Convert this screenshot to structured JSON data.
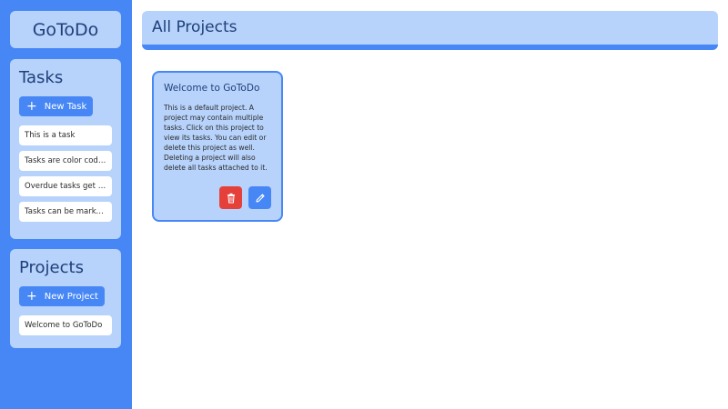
{
  "app": {
    "title": "GoToDo"
  },
  "sidebar": {
    "tasks": {
      "heading": "Tasks",
      "new_button": "New Task",
      "items": [
        {
          "label": "This is a task"
        },
        {
          "label": "Tasks are color coded"
        },
        {
          "label": "Overdue tasks get re..."
        },
        {
          "label": "Tasks can be marked ..."
        }
      ]
    },
    "projects": {
      "heading": "Projects",
      "new_button": "New Project",
      "items": [
        {
          "label": "Welcome to GoToDo"
        }
      ]
    }
  },
  "header": {
    "title": "All Projects"
  },
  "projects": [
    {
      "title": "Welcome to GoToDo",
      "description": "This is a default project. A project may contain multiple tasks. Click on this project to view its tasks. You can edit or delete this project as well. Deleting a project will also delete all tasks attached to it."
    }
  ],
  "icons": {
    "plus": "plus-icon",
    "delete": "trash-icon",
    "edit": "pencil-icon"
  },
  "colors": {
    "sidebar_bg": "#4787f5",
    "panel_bg": "#b7d3fb",
    "accent": "#4787f5",
    "danger": "#e5413a",
    "text_dark": "#1f3f7a"
  }
}
